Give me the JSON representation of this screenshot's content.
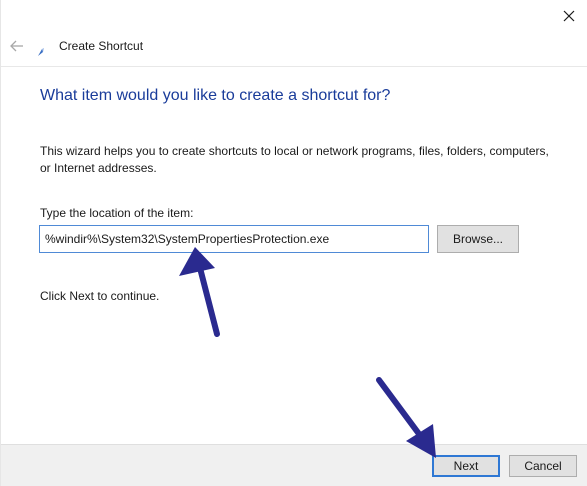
{
  "window": {
    "close_icon": "close-icon",
    "back_icon": "back-arrow-icon"
  },
  "header": {
    "title": "Create Shortcut",
    "icon": "shortcut-wizard-icon"
  },
  "main": {
    "heading": "What item would you like to create a shortcut for?",
    "description": "This wizard helps you to create shortcuts to local or network programs, files, folders, computers, or Internet addresses.",
    "location_label": "Type the location of the item:",
    "location_value": "%windir%\\System32\\SystemPropertiesProtection.exe",
    "browse_label": "Browse...",
    "continue_text": "Click Next to continue."
  },
  "footer": {
    "next_label": "Next",
    "cancel_label": "Cancel"
  },
  "annotations": {
    "arrow_color": "#2a2a8f",
    "arrows": [
      "pointer-arrow-to-location-field",
      "pointer-arrow-to-next-button"
    ]
  }
}
